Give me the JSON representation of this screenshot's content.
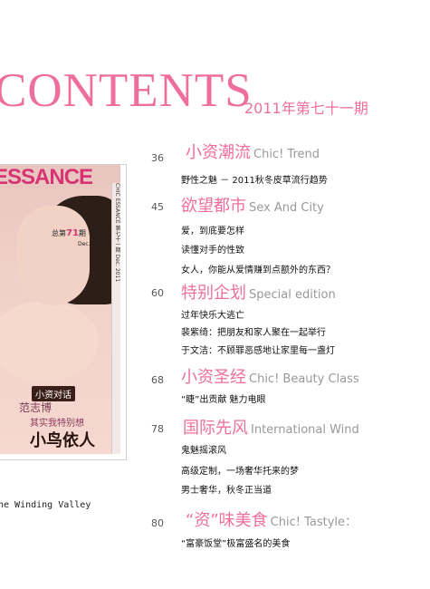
{
  "header": {
    "title": "CONTENTS",
    "issue": "2011年第七十一期"
  },
  "cover": {
    "magazine_name": "ESSANCE",
    "issue_no": "总第 71 期 （下）",
    "issue_no_prefix": "总第",
    "issue_no_value": "71",
    "issue_no_suffix": "期 （下）",
    "date": "Dec. 2011",
    "spine_text": "CHIC ESSANCE 第七十一期 Dec. 2011",
    "badge": "小资对话",
    "name": "范志博",
    "quote": "其实我特别想",
    "headline": "小鸟依人"
  },
  "caption": "ne Winding Valley",
  "sections": [
    {
      "page": "36",
      "title_cn": "小资潮流",
      "title_en": "Chic! Trend",
      "items": [
        "野性之魅 － 2011秋冬皮草流行趋势"
      ]
    },
    {
      "page": "45",
      "title_cn": "欲望都市",
      "title_en": "Sex And City",
      "items": [
        "爱，到底要怎样",
        "读懂对手的性致",
        "女人，你能从爱情赚到点额外的东西？"
      ]
    },
    {
      "page": "60",
      "title_cn": "特别企划",
      "title_en": "Special edition",
      "items": [
        "过年快乐大逃亡",
        "裴紫绮：把朋友和家人聚在一起举行",
        "于文洁：不顾罪恶感地让家里每一盏灯"
      ]
    },
    {
      "page": "68",
      "title_cn": "小资圣经",
      "title_en": "Chic! Beauty Class",
      "items": [
        "“睫”出贡献 魅力电眼"
      ]
    },
    {
      "page": "78",
      "title_cn": "国际先风",
      "title_en": "International Wind",
      "items": [
        "鬼魅摇滚风",
        "高级定制，一场奢华托来的梦",
        "男士奢华，秋冬正当道"
      ]
    },
    {
      "page": "80",
      "title_cn": "“资”味美食",
      "title_en": "Chic! Tastyle：",
      "items": [
        "“富豪饭堂”极富盛名的美食"
      ]
    }
  ]
}
